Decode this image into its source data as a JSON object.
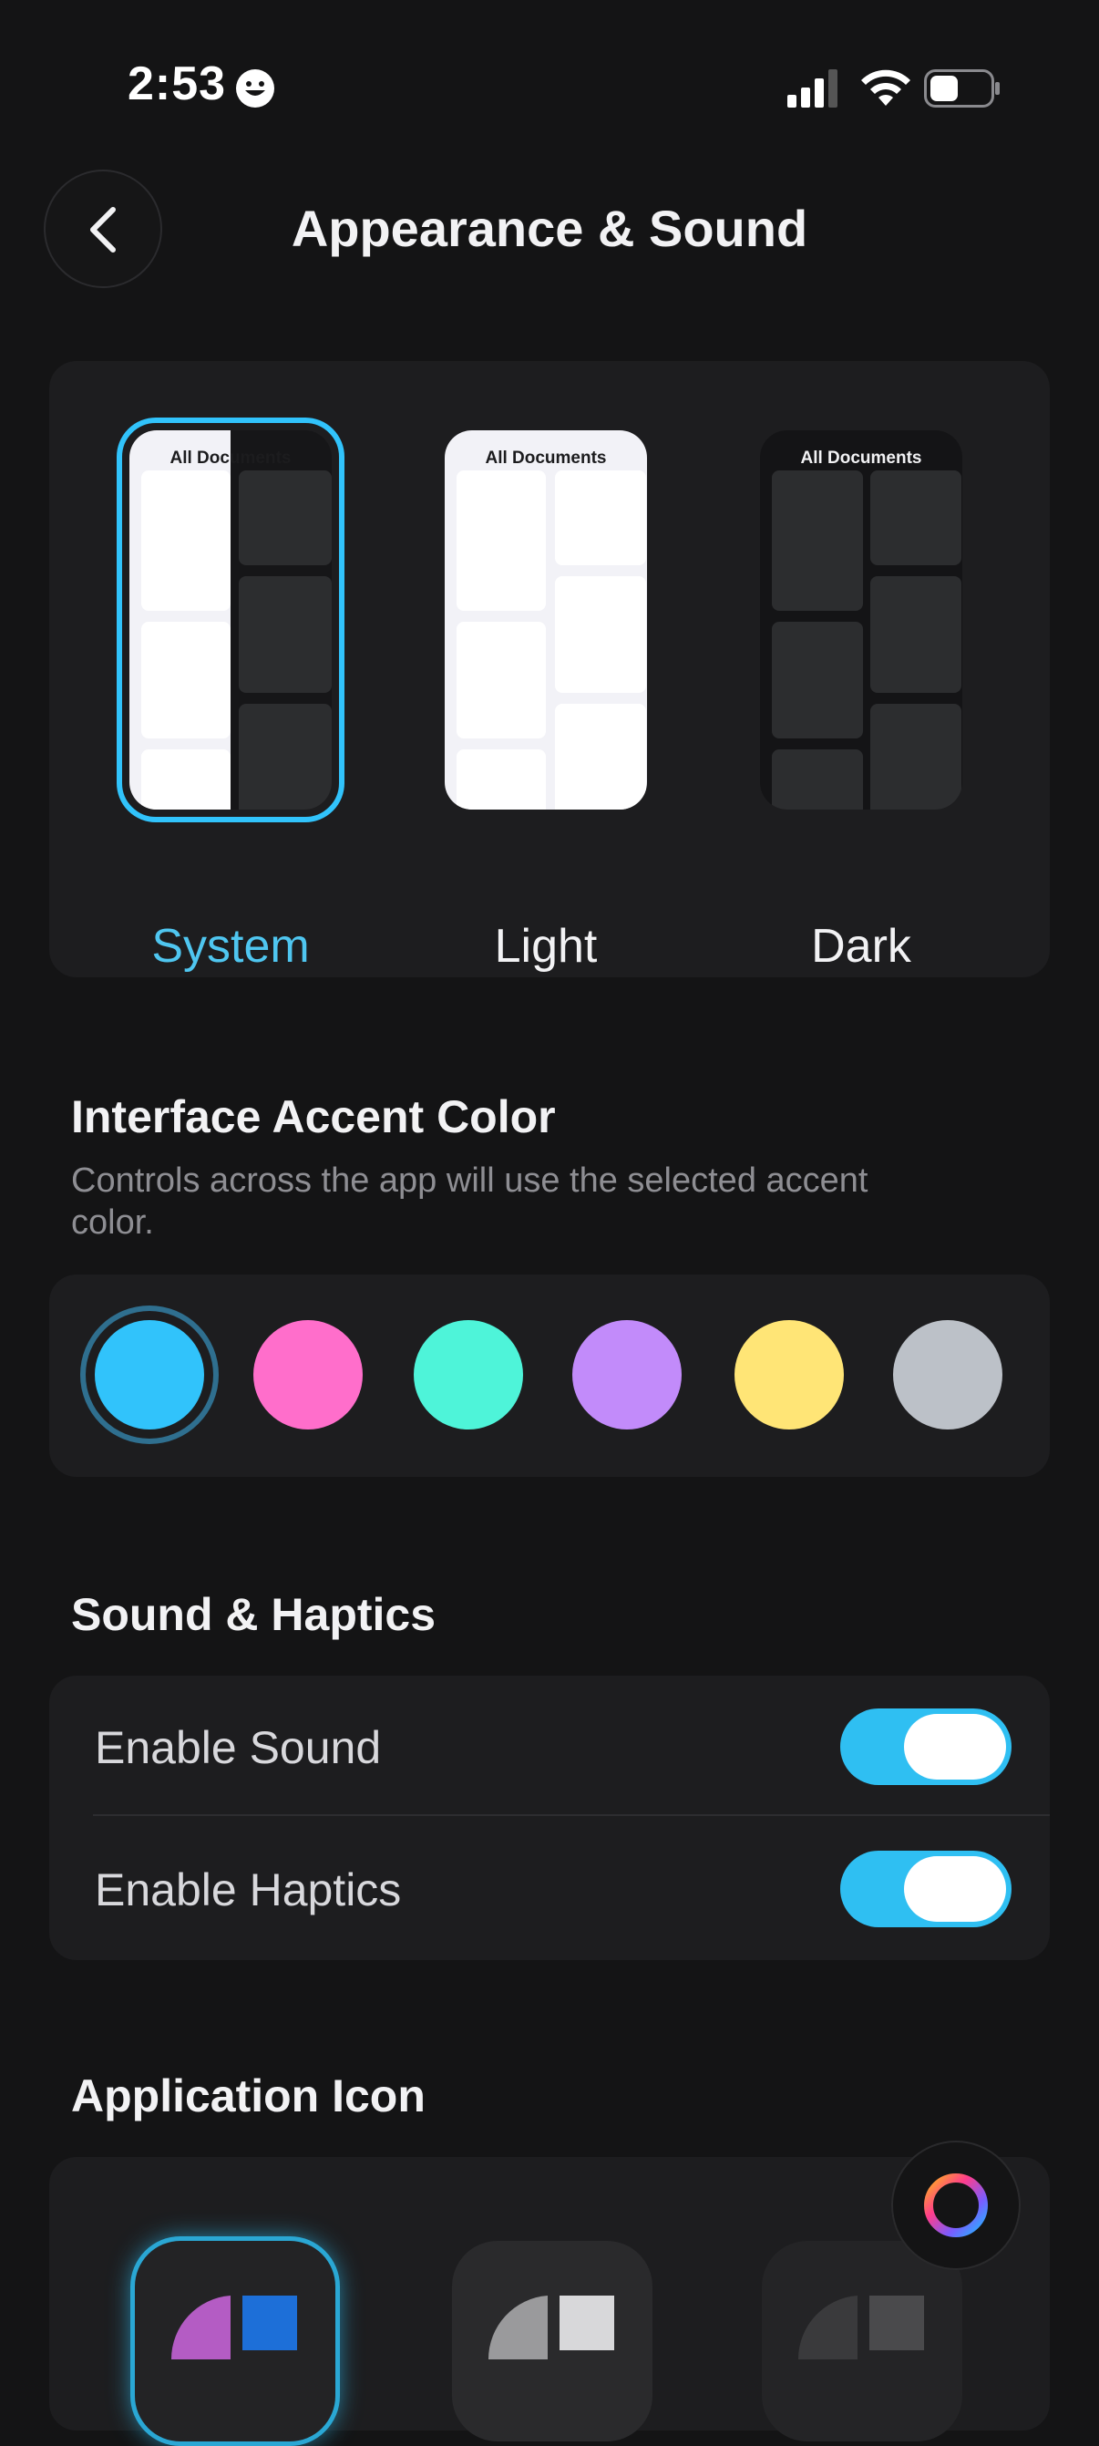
{
  "status": {
    "time": "2:53"
  },
  "header": {
    "title": "Appearance & Sound"
  },
  "appearance": {
    "options": [
      {
        "label": "System",
        "preview_title": "All Documents",
        "selected": true
      },
      {
        "label": "Light",
        "preview_title": "All Documents",
        "selected": false
      },
      {
        "label": "Dark",
        "preview_title": "All Documents",
        "selected": false
      }
    ]
  },
  "accent": {
    "title": "Interface Accent Color",
    "subtitle": "Controls across the app will use the selected accent color.",
    "colors": [
      "#31c3fb",
      "#ff6ecb",
      "#4ef4d9",
      "#c28bfa",
      "#ffe576",
      "#bcc1c8"
    ],
    "selected_index": 0
  },
  "sound": {
    "title": "Sound & Haptics",
    "enable_sound_label": "Enable Sound",
    "enable_sound": true,
    "enable_haptics_label": "Enable Haptics",
    "enable_haptics": true
  },
  "app_icon": {
    "title": "Application Icon"
  },
  "colors": {
    "accent": "#31c3fb",
    "background": "#141415",
    "card": "#1d1d1f"
  }
}
